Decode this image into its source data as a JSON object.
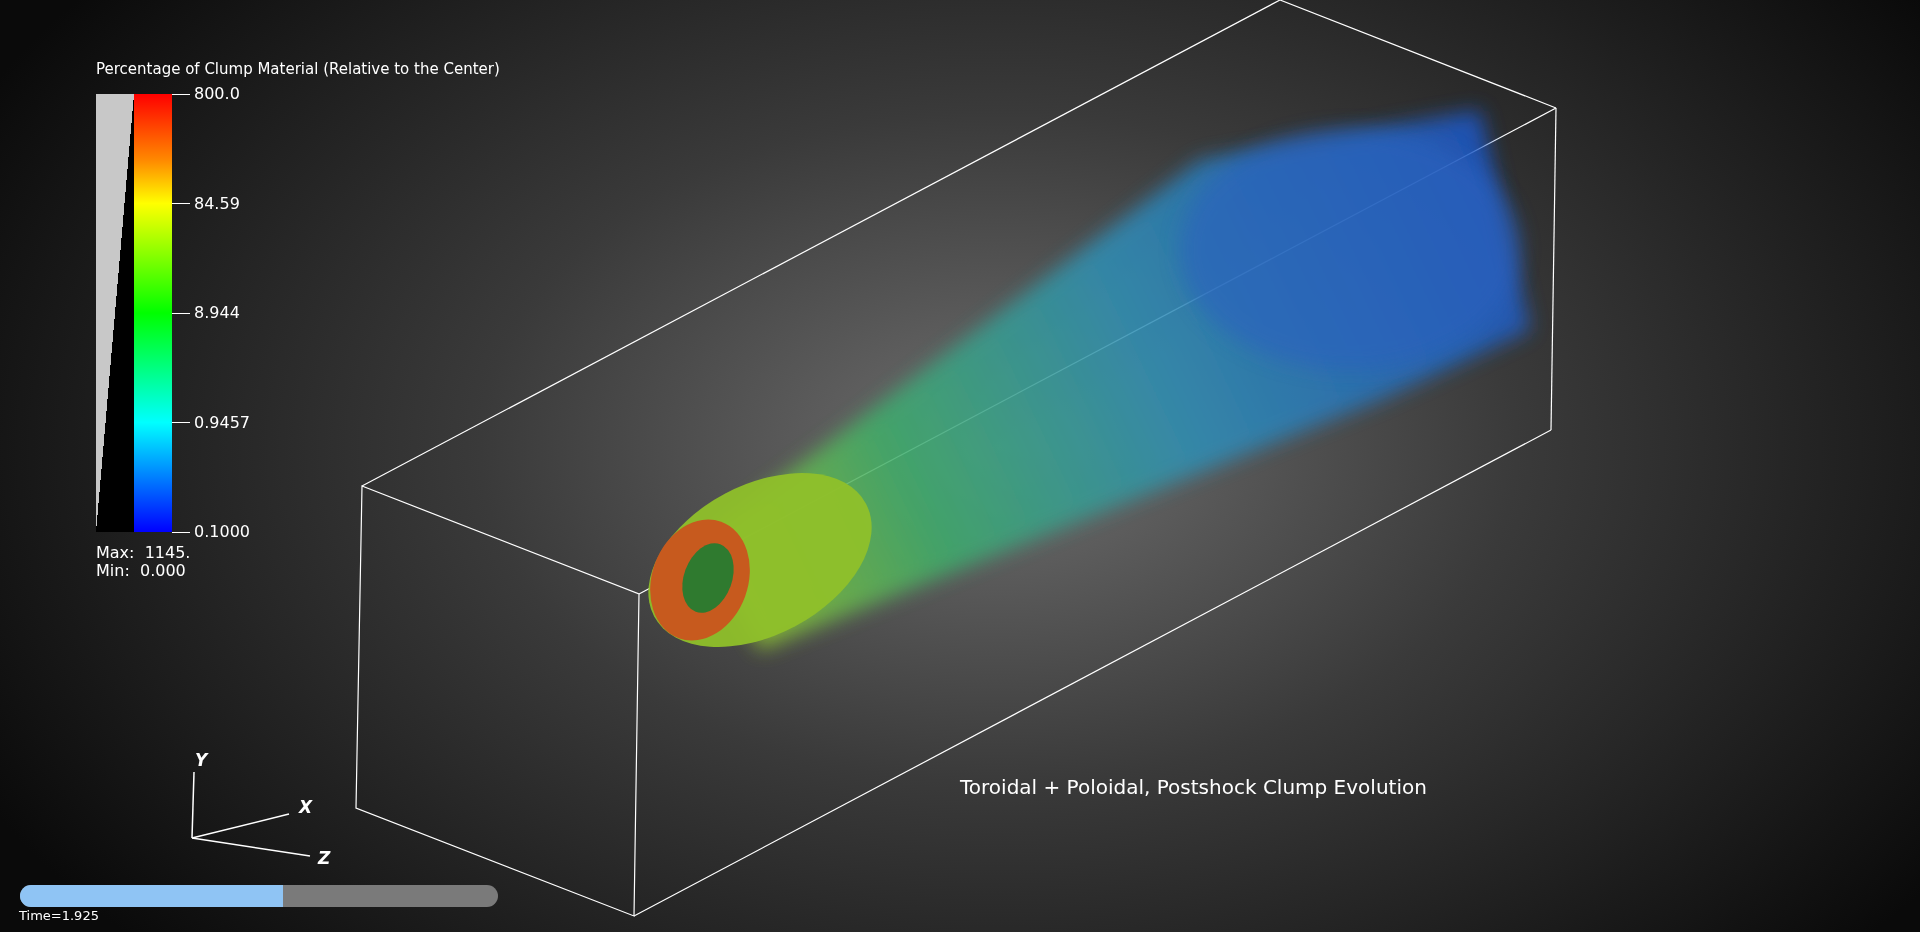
{
  "legend": {
    "title": "Percentage of Clump Material (Relative to the Center)",
    "ticks": [
      "800.0",
      "84.59",
      "8.944",
      "0.9457",
      "0.1000"
    ],
    "max": "Max:  1145.",
    "min": "Min:  0.000"
  },
  "caption": "Toroidal + Poloidal, Postshock Clump Evolution",
  "axes": {
    "y": "Y",
    "x": "X",
    "z": "Z"
  },
  "time": {
    "level": 0.55,
    "label": "Time=1.925"
  }
}
